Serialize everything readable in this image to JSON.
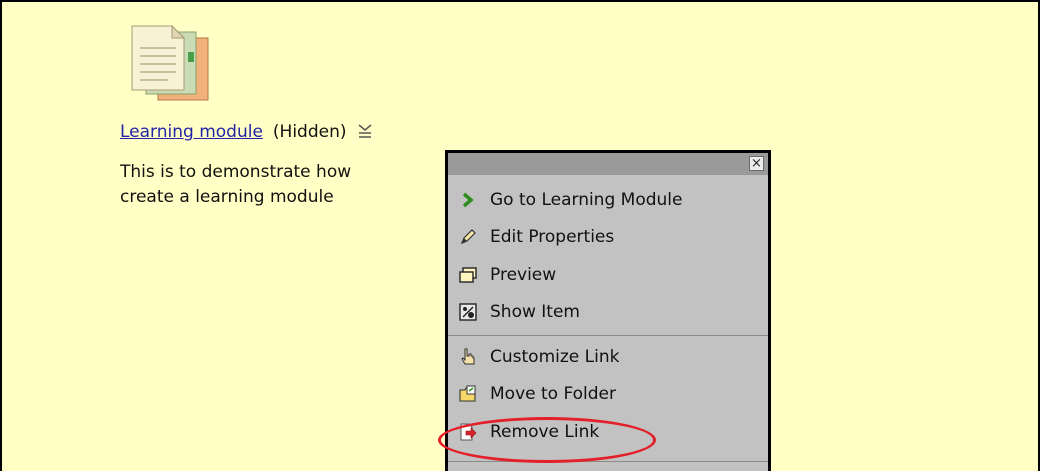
{
  "item": {
    "title": "Learning module ",
    "status": "(Hidden)",
    "description_lines": [
      "This is to demonstrate how",
      "create a learning module"
    ],
    "icon": "document-stack-icon",
    "menu_trigger_icon": "menu-chevron-icon"
  },
  "context_menu": {
    "close_label": "×",
    "groups": [
      [
        {
          "label": "Go to Learning Module",
          "icon": "green-arrow-icon"
        },
        {
          "label": "Edit Properties",
          "icon": "pencil-icon"
        },
        {
          "label": "Preview",
          "icon": "preview-window-icon"
        },
        {
          "label": "Show Item",
          "icon": "show-item-icon"
        }
      ],
      [
        {
          "label": "Customize Link",
          "icon": "hand-pointer-icon"
        },
        {
          "label": "Move to Folder",
          "icon": "folder-move-icon"
        },
        {
          "label": "Remove Link",
          "icon": "remove-link-icon"
        }
      ]
    ]
  },
  "colors": {
    "page_background": "#ffffc6",
    "link": "#2323a8",
    "menu_background": "#c2c2c2",
    "menu_header": "#9a9a9a",
    "highlight": "#e3202a"
  }
}
